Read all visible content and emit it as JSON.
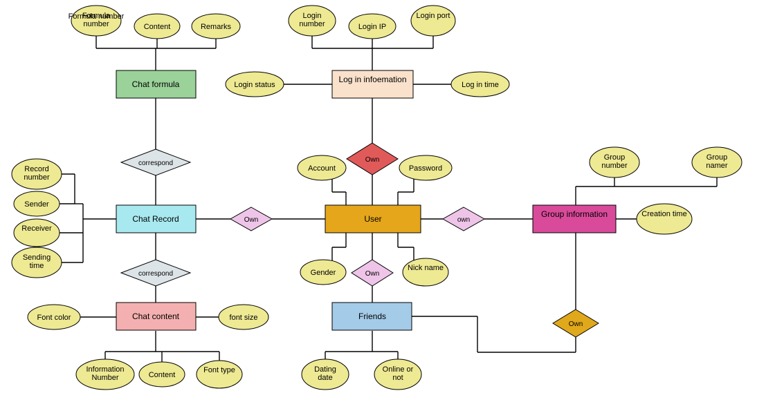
{
  "entities": {
    "chat_formula": {
      "label": "Chat formula",
      "fill": "#9AD29A"
    },
    "chat_record": {
      "label": "Chat Record",
      "fill": "#A8E9F0"
    },
    "chat_content": {
      "label": "Chat content",
      "fill": "#F4B0B0"
    },
    "log_in_info": {
      "label": "Log in infoemation",
      "fill": "#F9E1CB"
    },
    "user": {
      "label": "User",
      "fill": "#E5A61B"
    },
    "friends": {
      "label": "Friends",
      "fill": "#A4CBE8"
    },
    "group_info": {
      "label": "Group information",
      "fill": "#D94A9A"
    }
  },
  "relationships": {
    "correspond1": {
      "label": "correspond",
      "fill": "#DDE4E8"
    },
    "correspond2": {
      "label": "correspond",
      "fill": "#DDE4E8"
    },
    "own_chat": {
      "label": "Own",
      "fill": "#EEC5E8"
    },
    "own_login": {
      "label": "Own",
      "fill": "#E05A5A"
    },
    "own_group": {
      "label": "own",
      "fill": "#EEC5E8"
    },
    "own_friends": {
      "label": "Own",
      "fill": "#EEC5E8"
    },
    "own_friends_group": {
      "label": "Own",
      "fill": "#E0A81B"
    }
  },
  "attributes": {
    "formula_number": "Formula number",
    "formula_content": "Content",
    "formula_remarks": "Remarks",
    "login_number": "Login number",
    "login_ip": "Login IP",
    "login_port": "Login port",
    "login_status": "Login status",
    "login_time": "Log in time",
    "record_number": "Record number",
    "sender": "Sender",
    "receiver": "Receiver",
    "sending_time": "Sending time",
    "account": "Account",
    "password": "Password",
    "gender": "Gender",
    "nick_name": "Nick name",
    "group_number": "Group number",
    "group_namer": "Group namer",
    "creation_time": "Creation time",
    "font_color": "Font color",
    "font_size": "font size",
    "info_number": "Information Number",
    "content": "Content",
    "font_type": "Font type",
    "dating_date": "Dating date",
    "online_or_not": "Online or not"
  }
}
